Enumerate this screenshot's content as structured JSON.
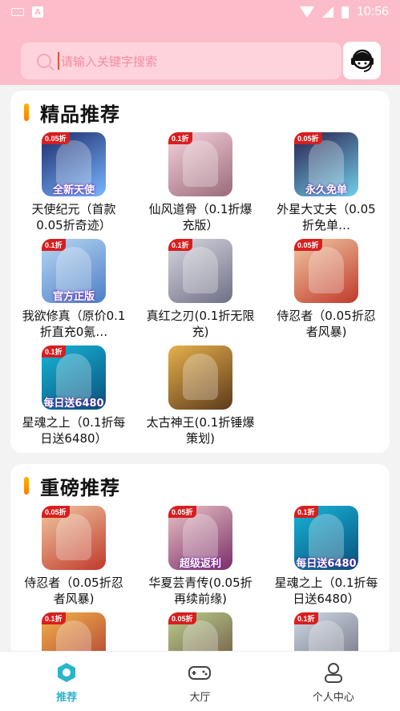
{
  "status_bar": {
    "time": "10:56",
    "icons": [
      "keyboard-icon",
      "a-notification-icon",
      "wifi-icon",
      "signal-icon",
      "battery-icon"
    ]
  },
  "search": {
    "placeholder": "请输入关键字搜索"
  },
  "header": {
    "service_icon": "customer-service-headset-icon"
  },
  "sections": [
    {
      "title": "精品推荐",
      "games": [
        {
          "name": "天使纪元（首款0.05折奇迹）",
          "tag": "0.05折",
          "banner": "全新天使",
          "colors": [
            "#1b2b6a",
            "#7ab6ff"
          ]
        },
        {
          "name": "仙风道骨（0.1折爆充版）",
          "tag": "0.1折",
          "banner": "",
          "colors": [
            "#f6d2dc",
            "#9a6b7a"
          ]
        },
        {
          "name": "外星大丈夫（0.05折免单…",
          "tag": "0.05折",
          "banner": "永久免单",
          "colors": [
            "#2a1e4d",
            "#6fd0e9"
          ]
        },
        {
          "name": "我欲修真（原价0.1折直充0氪…",
          "tag": "0.1折",
          "banner": "官方正版",
          "colors": [
            "#b9d7f3",
            "#4b7ec7"
          ]
        },
        {
          "name": "真红之刃(0.1折无限充)",
          "tag": "0.1折",
          "banner": "",
          "colors": [
            "#d8d8e0",
            "#6f6f86"
          ]
        },
        {
          "name": "侍忍者（0.05折忍者风暴)",
          "tag": "0.05折",
          "banner": "",
          "colors": [
            "#f1c9a2",
            "#c0392b"
          ]
        },
        {
          "name": "星魂之上（0.1折每日送6480）",
          "tag": "0.1折",
          "banner": "每日送6480",
          "colors": [
            "#17b5d8",
            "#0a4f7a"
          ]
        },
        {
          "name": "太古神王(0.1折锤爆策划)",
          "tag": "",
          "banner": "",
          "colors": [
            "#e5b04c",
            "#5d3a1a"
          ]
        }
      ]
    },
    {
      "title": "重磅推荐",
      "games": [
        {
          "name": "侍忍者（0.05折忍者风暴)",
          "tag": "0.05折",
          "banner": "",
          "colors": [
            "#f1c9a2",
            "#c0392b"
          ]
        },
        {
          "name": "华夏芸青传(0.05折再续前缘)",
          "tag": "0.05折",
          "banner": "超级返利",
          "colors": [
            "#e9c4c4",
            "#7b2d6a"
          ]
        },
        {
          "name": "星魂之上（0.1折每日送6480）",
          "tag": "0.1折",
          "banner": "每日送6480",
          "colors": [
            "#17b5d8",
            "#0a4f7a"
          ]
        },
        {
          "name": "",
          "tag": "0.1折",
          "banner": "",
          "colors": [
            "#f1b34a",
            "#a33"
          ]
        },
        {
          "name": "",
          "tag": "0.05折",
          "banner": "",
          "colors": [
            "#b9d08f",
            "#6a4a3a"
          ]
        },
        {
          "name": "",
          "tag": "0.1折",
          "banner": "",
          "colors": [
            "#cfd8e6",
            "#6a6a7a"
          ]
        }
      ]
    }
  ],
  "tabs": [
    {
      "label": "推荐",
      "icon": "recommend-icon",
      "active": true
    },
    {
      "label": "大厅",
      "icon": "gamepad-icon",
      "active": false
    },
    {
      "label": "个人中心",
      "icon": "user-icon",
      "active": false
    }
  ],
  "colors": {
    "header_bg": "#fdbcc9",
    "accent": "#2ab5c9",
    "section_bar": "#ff9a00"
  }
}
